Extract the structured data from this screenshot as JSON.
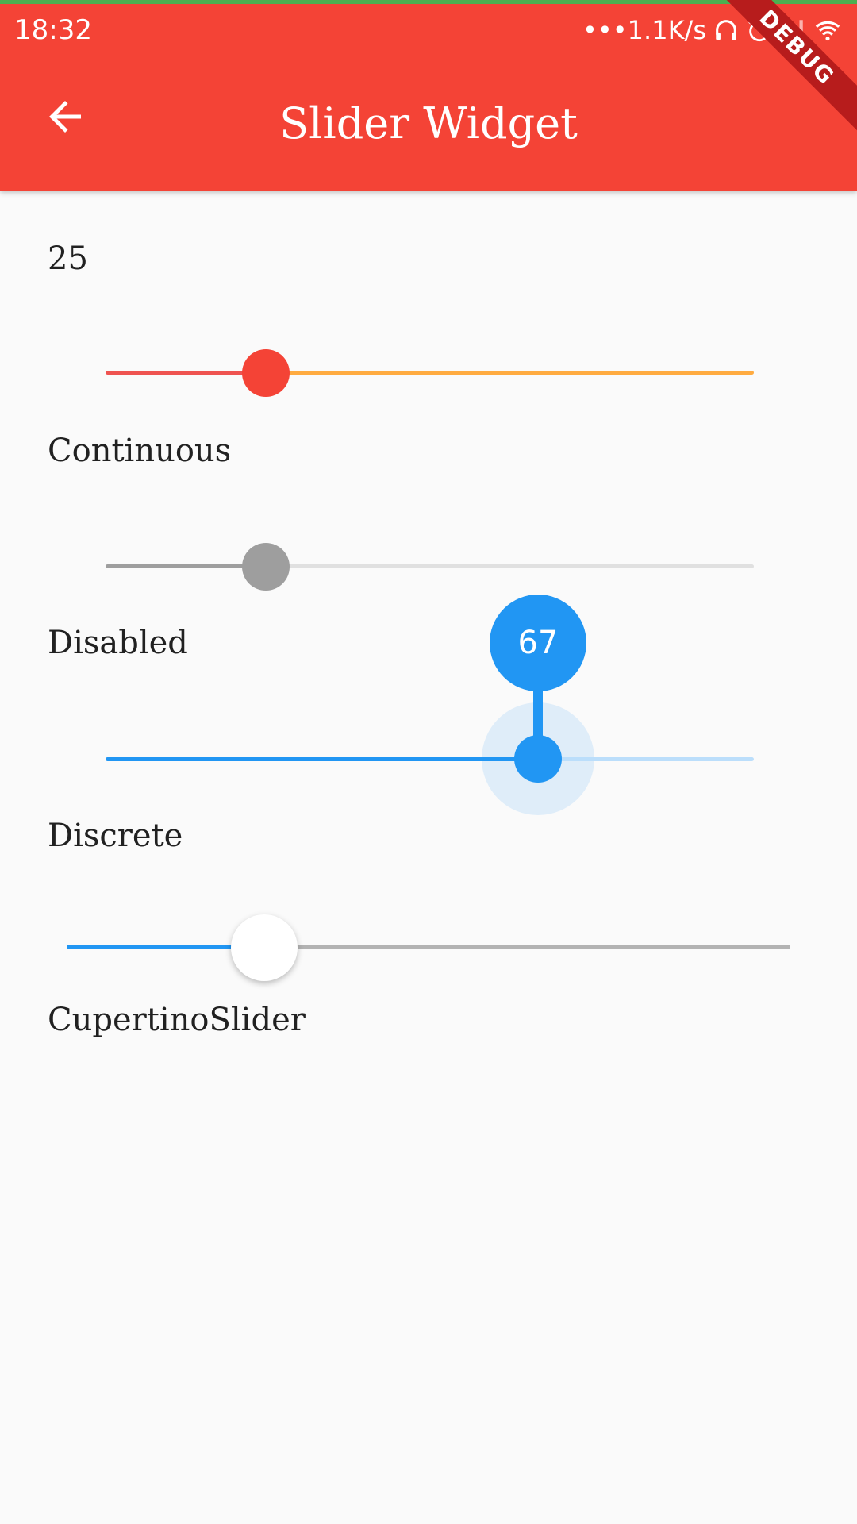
{
  "status_bar": {
    "time": "18:32",
    "network_speed": "•••1.1K/s",
    "icons": [
      "headphones-icon",
      "alarm-icon",
      "signal-icon",
      "wifi-icon"
    ]
  },
  "app_bar": {
    "title": "Slider Widget",
    "back_icon": "arrow-back-icon",
    "debug_banner": "DEBUG",
    "color": "#f44336"
  },
  "sliders": {
    "continuous": {
      "value_text": "25",
      "label": "Continuous",
      "value": 25,
      "min": 0,
      "max": 100,
      "active_color": "#f44336",
      "inactive_color": "#ffab40"
    },
    "disabled": {
      "label": "Disabled",
      "value": 25,
      "min": 0,
      "max": 100,
      "enabled": false
    },
    "discrete": {
      "label": "Discrete",
      "value": 67,
      "value_indicator": "67",
      "min": 0,
      "max": 100,
      "active_color": "#2196f3"
    },
    "cupertino": {
      "label": "CupertinoSlider",
      "value": 25,
      "min": 0,
      "max": 100,
      "active_color": "#2196f3"
    }
  }
}
